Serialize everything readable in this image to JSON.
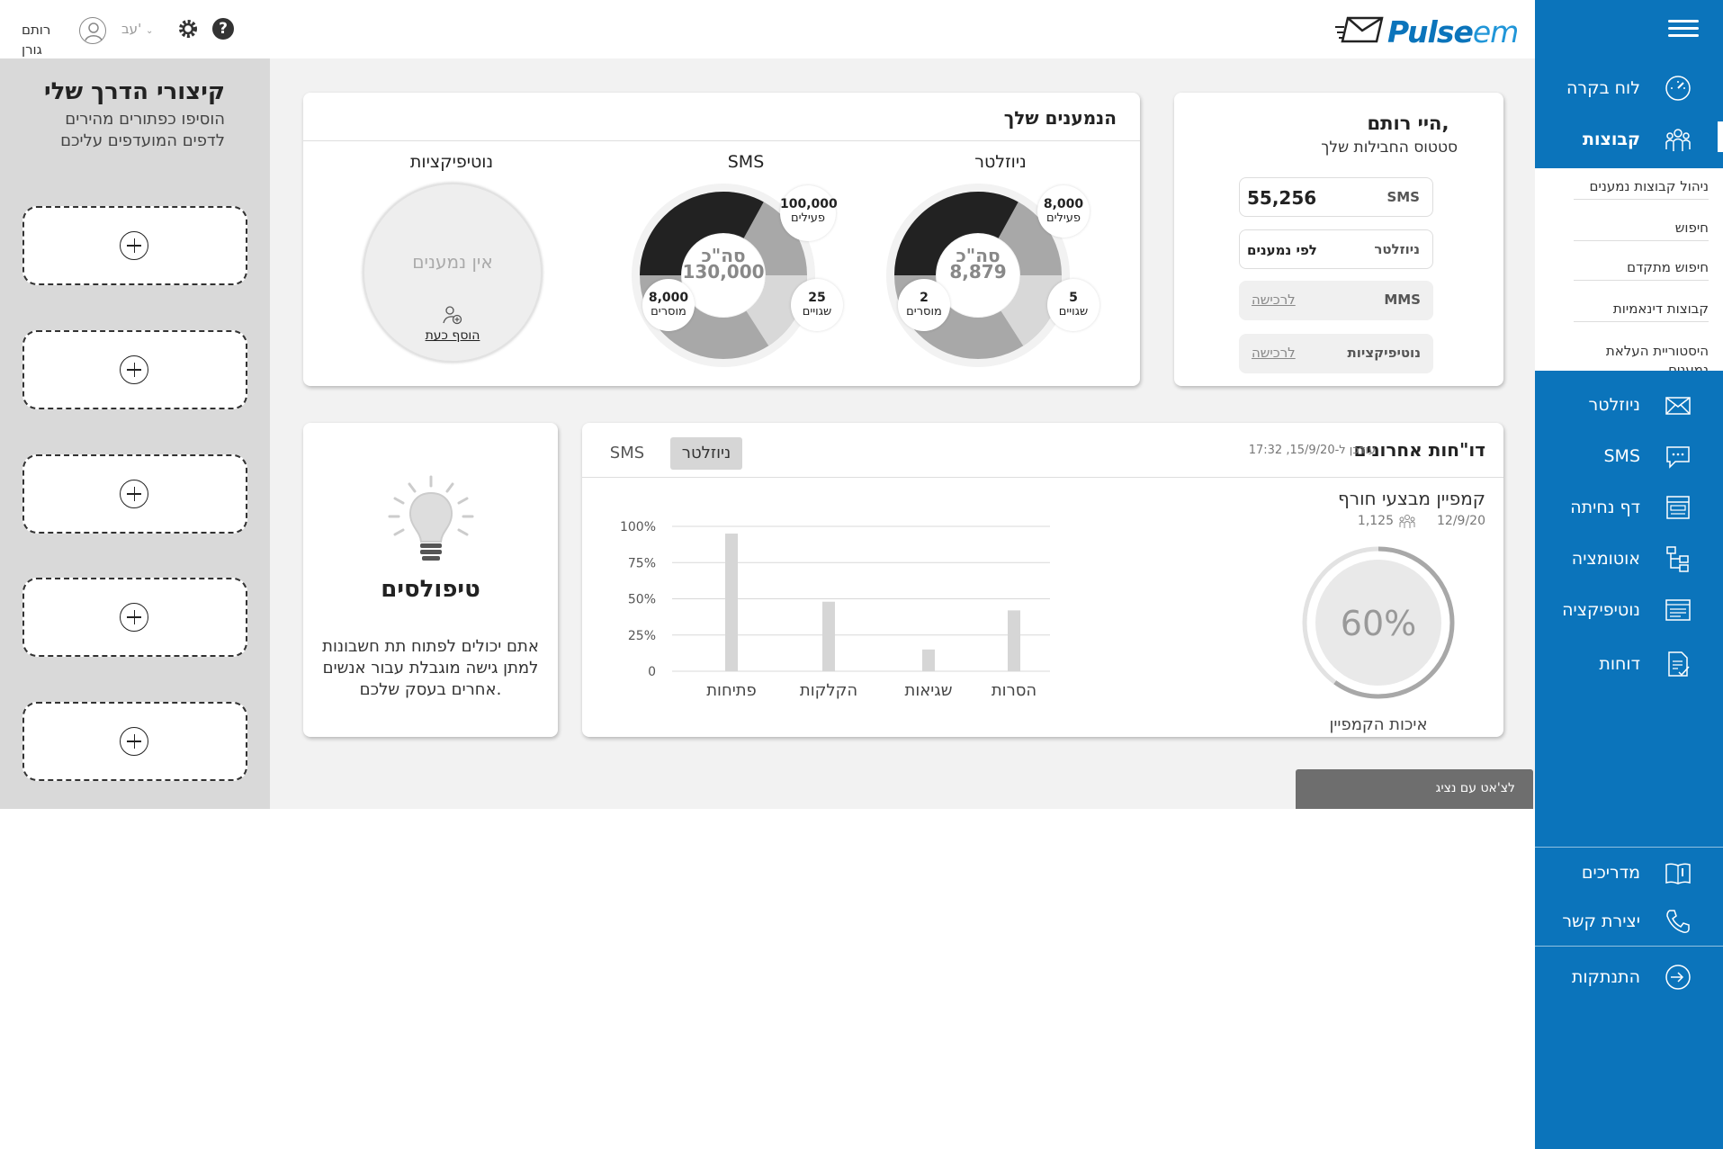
{
  "header": {
    "logo_text_bold": "Pulse",
    "logo_text_light": "em",
    "language": "עב'",
    "user_name": "רותם גורן"
  },
  "sidebar": {
    "items": [
      {
        "label": "לוח בקרה",
        "icon": "dashboard-gauge-icon"
      },
      {
        "label": "קבוצות",
        "icon": "groups-icon",
        "active": true
      },
      {
        "label": "ניוזלטר",
        "icon": "newsletter-envelope-icon"
      },
      {
        "label": "SMS",
        "icon": "sms-chat-icon"
      },
      {
        "label": "דף נחיתה",
        "icon": "landing-page-icon"
      },
      {
        "label": "אוטומציה",
        "icon": "automation-flow-icon"
      },
      {
        "label": "נוטיפיקציה",
        "icon": "notification-icon"
      },
      {
        "label": "דוחות",
        "icon": "reports-document-icon"
      }
    ],
    "submenu": [
      "ניהול קבוצות נמענים",
      "חיפוש",
      "חיפוש מתקדם",
      "קבוצות דינאמיות",
      "היסטוריית העלאת נמענים"
    ],
    "bottom_items": [
      {
        "label": "מדריכים",
        "icon": "guides-book-icon"
      },
      {
        "label": "יצירת קשר",
        "icon": "phone-icon"
      },
      {
        "label": "התנתקות",
        "icon": "logout-icon"
      }
    ]
  },
  "shortcuts": {
    "title": "קיצורי הדרך שלי",
    "subtitle": "הוסיפו כפתורים מהירים לדפים המועדפים עליכם",
    "slot_count": 5
  },
  "greeting": {
    "title": "היי רותם,",
    "subtitle": "סטטוס החבילות שלך",
    "rows": [
      {
        "label": "SMS",
        "value": "55,256"
      },
      {
        "label": "ניוזלטר",
        "value": "לפי נמענים"
      },
      {
        "label": "MMS",
        "link": "לרכישה"
      },
      {
        "label": "נוטיפיקציות",
        "link": "לרכישה"
      }
    ]
  },
  "subscribers": {
    "title": "הנמענים שלך",
    "newsletter": {
      "title": "ניוזלטר",
      "total_label": "סה\"כ",
      "total": "8,879",
      "active": "8,000",
      "active_label": "פעילים",
      "errors": "5",
      "errors_label": "שגויים",
      "removed": "2",
      "removed_label": "מוסרים"
    },
    "sms": {
      "title": "SMS",
      "total_label": "סה\"כ",
      "total": "130,000",
      "active": "100,000",
      "active_label": "פעילים",
      "errors": "25",
      "errors_label": "שגויים",
      "removed": "8,000",
      "removed_label": "מוסרים"
    },
    "notifications": {
      "title": "נוטיפיקציות",
      "empty_text": "אין נמענים",
      "add_link": "הוסף כעת"
    }
  },
  "reports": {
    "title": "דו\"חות אחרונים",
    "updated": "עודכן ל-15/9/20, 17:32",
    "tabs": [
      "ניוזלטר",
      "SMS"
    ],
    "campaign_name": "קמפיין מבצעי חורף",
    "campaign_date": "12/9/20",
    "campaign_recipients": "1,125",
    "quality_value": "60%",
    "quality_label": "איכות הקמפיין"
  },
  "chart_data": {
    "type": "bar",
    "categories": [
      "פתיחות",
      "הקלקות",
      "שגיאות",
      "הסרות"
    ],
    "values": [
      95,
      48,
      15,
      42
    ],
    "ylim": [
      0,
      100
    ],
    "yticks": [
      "0",
      "25%",
      "50%",
      "75%",
      "100%"
    ],
    "grid": true
  },
  "tip": {
    "title": "טיפולסים",
    "text": "אתם יכולים לפתוח תת חשבונות למתן גישה מוגבלת עבור אנשים אחרים בעסק שלכם."
  },
  "cta": {
    "label": "לצ'אט עם נציג"
  }
}
